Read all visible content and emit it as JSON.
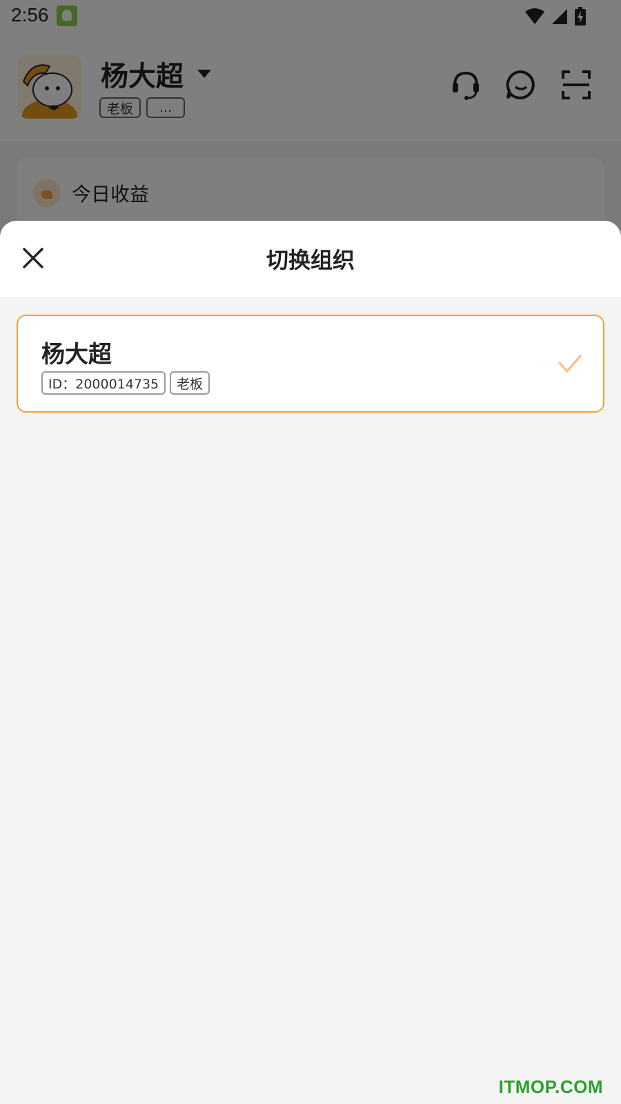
{
  "status_bar": {
    "time": "2:56",
    "app_icon": "android-app-icon",
    "icons": [
      "wifi-icon",
      "signal-icon",
      "battery-charging-icon"
    ]
  },
  "header": {
    "user_name": "杨大超",
    "tags": [
      "老板",
      "..."
    ],
    "icons": [
      "customer-service-icon",
      "message-icon",
      "scan-icon"
    ]
  },
  "income_card": {
    "label": "今日收益"
  },
  "sheet": {
    "title": "切换组织",
    "close_icon": "close-icon",
    "orgs": [
      {
        "name": "杨大超",
        "id_tag": "ID：2000014735",
        "role_tag": "老板",
        "selected": true
      }
    ]
  },
  "watermark": "ITMOP.COM",
  "colors": {
    "accent": "#f2a23a",
    "overlay": "rgba(0,0,0,0.5)",
    "watermark": "#2ca02c"
  }
}
